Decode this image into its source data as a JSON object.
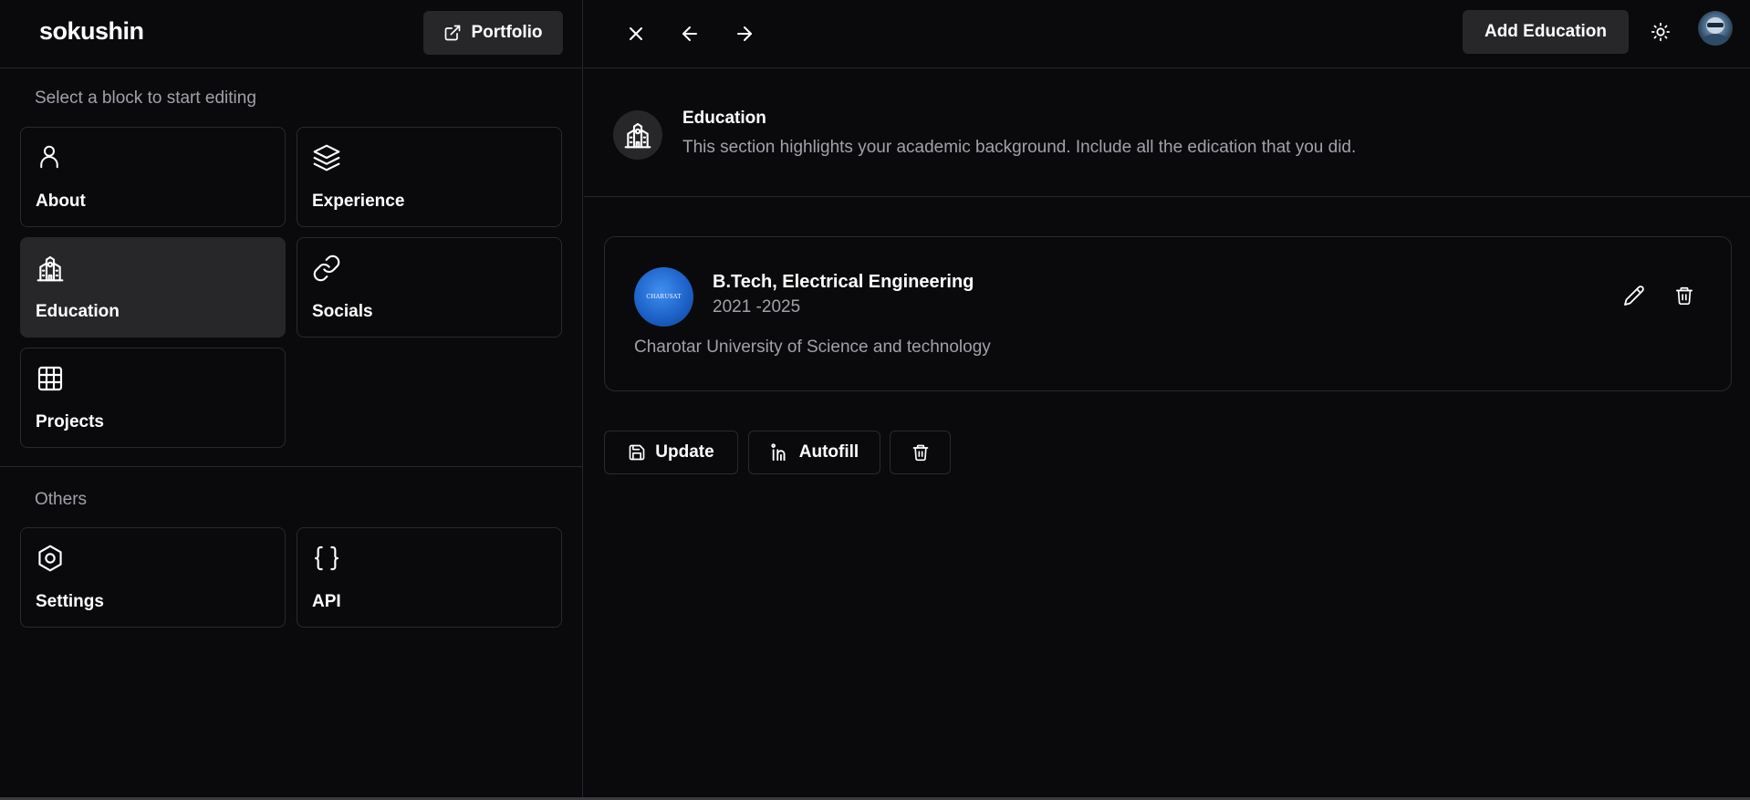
{
  "brand": "sokushin",
  "portfolio_button": {
    "label": "Portfolio",
    "icon": "external-link-icon"
  },
  "sidebar": {
    "prompt": "Select a block to start editing",
    "blocks": [
      {
        "label": "About",
        "icon": "user-icon",
        "active": false
      },
      {
        "label": "Experience",
        "icon": "layers-icon",
        "active": false
      },
      {
        "label": "Education",
        "icon": "school-icon",
        "active": true
      },
      {
        "label": "Socials",
        "icon": "link-icon",
        "active": false
      },
      {
        "label": "Projects",
        "icon": "grid-icon",
        "active": false
      }
    ],
    "others_label": "Others",
    "others": [
      {
        "label": "Settings",
        "icon": "hexagon-settings-icon"
      },
      {
        "label": "API",
        "icon": "braces-icon"
      }
    ]
  },
  "toolbar": {
    "add_label": "Add Education",
    "icons": [
      "close-icon",
      "arrow-left-icon",
      "arrow-right-icon",
      "sun-icon"
    ]
  },
  "section": {
    "title": "Education",
    "description": "This section highlights your academic background. Include all the edication that you did.",
    "icon": "school-icon"
  },
  "education": [
    {
      "degree": "B.Tech, Electrical Engineering",
      "years": "2021 -2025",
      "school": "Charotar University of Science and technology",
      "logo_text": "CHARUSAT"
    }
  ],
  "actions": {
    "update_label": "Update",
    "autofill_label": "Autofill"
  },
  "colors": {
    "background": "#0a0a0c",
    "surface": "#27272a",
    "border": "#2a2a2e",
    "muted_text": "#a1a1aa",
    "logo_blue": "#1e63c9"
  }
}
